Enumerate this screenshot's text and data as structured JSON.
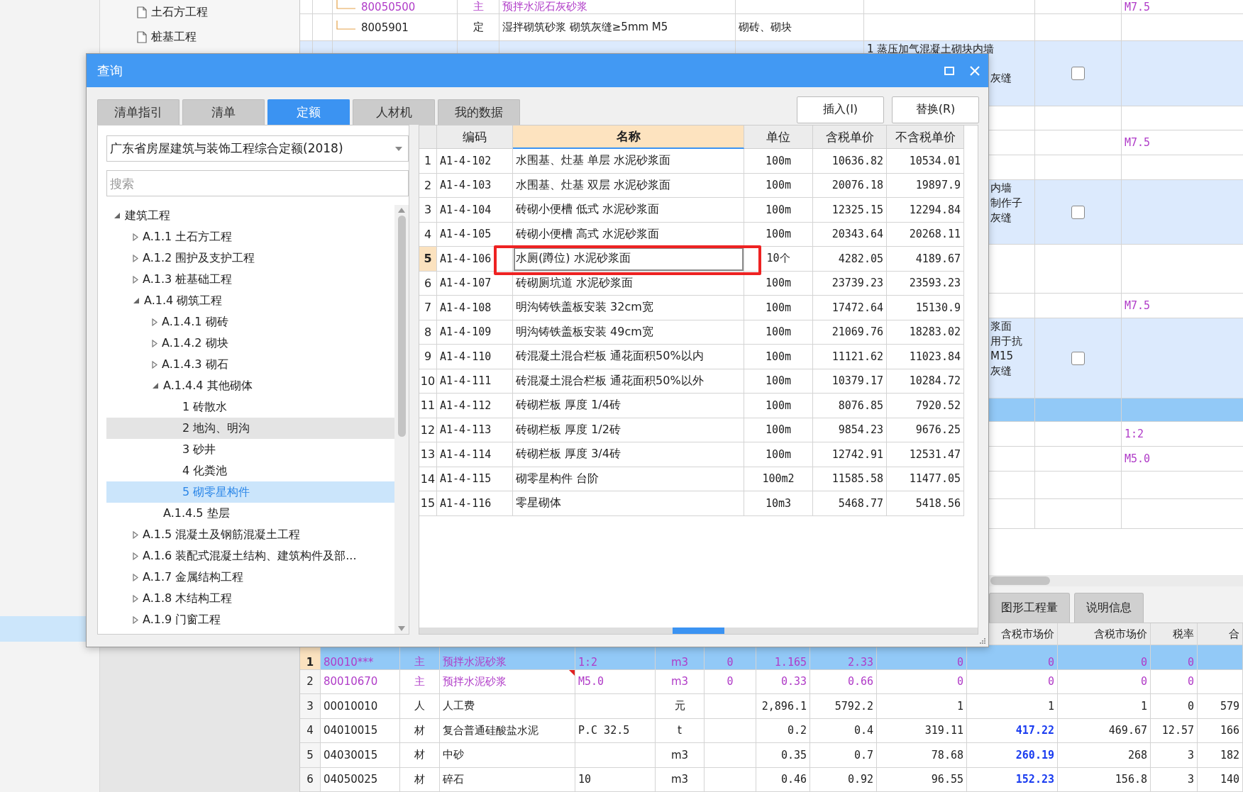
{
  "sidebar": {
    "items": [
      {
        "label": "土石方工程"
      },
      {
        "label": "桩基工程"
      }
    ]
  },
  "top_table": {
    "rows": [
      {
        "kind": "material",
        "selected": false,
        "code": "80050500",
        "type": "主",
        "name": "预拌水泥石灰砂浆",
        "ratio": "M7.5"
      },
      {
        "kind": "quota",
        "selected": false,
        "code": "8005901",
        "type": "定",
        "name": "湿拌砌筑砂浆 砌筑灰缝≥5mm M5",
        "spec": "砌砖、砌块"
      },
      {
        "kind": "item",
        "selected": false,
        "checked": false,
        "description": [
          {
            "text": "1 蒸压加气混凝土砌块内墙",
            "partial": false
          },
          {
            "text": "灰缝",
            "partial": true
          }
        ]
      },
      {
        "kind": "blank",
        "selected": false
      },
      {
        "kind": "material",
        "selected": false,
        "ratio": "M7.5"
      },
      {
        "kind": "blank",
        "selected": false
      },
      {
        "kind": "item",
        "selected": false,
        "checked": false,
        "description": [
          {
            "text": "内墙",
            "partial": true
          },
          {
            "text": "制作子",
            "partial": true
          },
          {
            "text": "灰缝",
            "partial": true
          }
        ]
      },
      {
        "kind": "blank",
        "selected": false
      },
      {
        "kind": "material",
        "selected": false,
        "ratio": "M7.5"
      },
      {
        "kind": "item",
        "selected": false,
        "checked": false,
        "description": [
          {
            "text": "浆面",
            "partial": true
          },
          {
            "text": "用于抗",
            "partial": true
          },
          {
            "text": "M15",
            "partial": true
          },
          {
            "text": "灰缝",
            "partial": true
          }
        ]
      },
      {
        "kind": "blank",
        "selected": true
      },
      {
        "kind": "material",
        "selected": false,
        "ratio": "1:2"
      },
      {
        "kind": "material",
        "selected": false,
        "ratio": "M5.0"
      },
      {
        "kind": "blank",
        "selected": false
      },
      {
        "kind": "blank",
        "selected": false
      }
    ]
  },
  "bottom_tabs": [
    {
      "label": "图形工程量",
      "selected": false
    },
    {
      "label": "说明信息",
      "selected": false
    }
  ],
  "bottom_table": {
    "header": [
      "含税市场价",
      "含税市场价",
      "税率",
      "合"
    ],
    "rows": [
      {
        "selected": true,
        "kind": "main",
        "price_changed": false,
        "has_note": false,
        "cells": [
          "1",
          "80010***",
          "主",
          "预拌水泥砂浆",
          "1:2",
          "m3",
          "0",
          "1.165",
          "2.33",
          "0",
          "0",
          "0",
          "0",
          null
        ]
      },
      {
        "selected": false,
        "kind": "main",
        "price_changed": false,
        "has_note": true,
        "cells": [
          "2",
          "80010670",
          "主",
          "预拌水泥砂浆",
          "M5.0",
          "m3",
          "0",
          "0.33",
          "0.66",
          "0",
          "0",
          "0",
          "0",
          null
        ]
      },
      {
        "selected": false,
        "kind": "normal",
        "price_changed": false,
        "has_note": false,
        "cells": [
          "3",
          "00010010",
          "人",
          "人工费",
          null,
          "元",
          null,
          "2,896.1",
          "5792.2",
          "1",
          "1",
          "1",
          "0",
          "579"
        ]
      },
      {
        "selected": false,
        "kind": "normal",
        "price_changed": true,
        "has_note": false,
        "cells": [
          "4",
          "04010015",
          "材",
          "复合普通硅酸盐水泥",
          "P.C 32.5",
          "t",
          null,
          "0.2",
          "0.4",
          "319.11",
          "417.22",
          "469.67",
          "12.57",
          "166"
        ]
      },
      {
        "selected": false,
        "kind": "normal",
        "price_changed": true,
        "has_note": false,
        "cells": [
          "5",
          "04030015",
          "材",
          "中砂",
          null,
          "m3",
          null,
          "0.35",
          "0.7",
          "78.68",
          "260.19",
          "268",
          "3",
          "182"
        ]
      },
      {
        "selected": false,
        "kind": "normal",
        "price_changed": true,
        "has_note": false,
        "cells": [
          "6",
          "04050025",
          "材",
          "碎石",
          "10",
          "m3",
          null,
          "0.46",
          "0.92",
          "96.55",
          "152.23",
          "156.8",
          "3",
          "140"
        ]
      }
    ]
  },
  "dialog": {
    "title": "查询",
    "tabs": [
      {
        "label": "清单指引",
        "selected": false
      },
      {
        "label": "清单",
        "selected": false
      },
      {
        "label": "定额",
        "selected": true
      },
      {
        "label": "人材机",
        "selected": false
      },
      {
        "label": "我的数据",
        "selected": false
      }
    ],
    "buttons": [
      "插入(I)",
      "替换(R)"
    ],
    "library": "广东省房屋建筑与装饰工程综合定额(2018)",
    "search_placeholder": "搜索",
    "tree": [
      {
        "label": "建筑工程",
        "expanded": true,
        "selected": false,
        "hovered": false,
        "children": [
          {
            "label": "A.1.1 土石方工程",
            "expanded": false,
            "selected": false,
            "hovered": false
          },
          {
            "label": "A.1.2 围护及支护工程",
            "expanded": false,
            "selected": false,
            "hovered": false
          },
          {
            "label": "A.1.3 桩基础工程",
            "expanded": false,
            "selected": false,
            "hovered": false
          },
          {
            "label": "A.1.4 砌筑工程",
            "expanded": true,
            "selected": false,
            "hovered": false,
            "children": [
              {
                "label": "A.1.4.1 砌砖",
                "expanded": false,
                "selected": false,
                "hovered": false
              },
              {
                "label": "A.1.4.2 砌块",
                "expanded": false,
                "selected": false,
                "hovered": false
              },
              {
                "label": "A.1.4.3 砌石",
                "expanded": false,
                "selected": false,
                "hovered": false
              },
              {
                "label": "A.1.4.4 其他砌体",
                "expanded": true,
                "selected": false,
                "hovered": false,
                "children": [
                  {
                    "label": "1 砖散水",
                    "selected": false,
                    "hovered": false
                  },
                  {
                    "label": "2 地沟、明沟",
                    "selected": false,
                    "hovered": true
                  },
                  {
                    "label": "3 砂井",
                    "selected": false,
                    "hovered": false
                  },
                  {
                    "label": "4 化粪池",
                    "selected": false,
                    "hovered": false
                  },
                  {
                    "label": "5 砌零星构件",
                    "selected": true,
                    "hovered": false
                  }
                ]
              },
              {
                "label": "A.1.4.5 垫层",
                "selected": false,
                "hovered": false
              }
            ]
          },
          {
            "label": "A.1.5 混凝土及钢筋混凝土工程",
            "expanded": false,
            "selected": false,
            "hovered": false
          },
          {
            "label": "A.1.6 装配式混凝土结构、建筑构件及部...",
            "expanded": false,
            "selected": false,
            "hovered": false
          },
          {
            "label": "A.1.7 金属结构工程",
            "expanded": false,
            "selected": false,
            "hovered": false
          },
          {
            "label": "A.1.8 木结构工程",
            "expanded": false,
            "selected": false,
            "hovered": false
          },
          {
            "label": "A.1.9 门窗工程",
            "expanded": false,
            "selected": false,
            "hovered": false
          }
        ]
      }
    ],
    "table": {
      "columns": [
        {
          "label": "编码",
          "selected": false
        },
        {
          "label": "名称",
          "selected": true
        },
        {
          "label": "单位",
          "selected": false
        },
        {
          "label": "含税单价",
          "selected": false
        },
        {
          "label": "不含税单价",
          "selected": false
        }
      ],
      "rows": [
        {
          "number": "1",
          "code": "A1-4-102",
          "name": "水围基、灶基 单层 水泥砂浆面",
          "unit": "100m",
          "price_tax": "10636.82",
          "price": "10534.01",
          "selected": false
        },
        {
          "number": "2",
          "code": "A1-4-103",
          "name": "水围基、灶基 双层 水泥砂浆面",
          "unit": "100m",
          "price_tax": "20076.18",
          "price": "19897.9",
          "selected": false
        },
        {
          "number": "3",
          "code": "A1-4-104",
          "name": "砖砌小便槽 低式 水泥砂浆面",
          "unit": "100m",
          "price_tax": "12325.15",
          "price": "12294.84",
          "selected": false
        },
        {
          "number": "4",
          "code": "A1-4-105",
          "name": "砖砌小便槽 高式 水泥砂浆面",
          "unit": "100m",
          "price_tax": "20343.64",
          "price": "20268.11",
          "selected": false
        },
        {
          "number": "5",
          "code": "A1-4-106",
          "name": "水厕(蹲位) 水泥砂浆面",
          "unit": "10个",
          "price_tax": "4282.05",
          "price": "4189.67",
          "selected": true
        },
        {
          "number": "6",
          "code": "A1-4-107",
          "name": "砖砌厕坑道 水泥砂浆面",
          "unit": "100m",
          "price_tax": "23739.23",
          "price": "23593.23",
          "selected": false
        },
        {
          "number": "7",
          "code": "A1-4-108",
          "name": "明沟铸铁盖板安装 32cm宽",
          "unit": "100m",
          "price_tax": "17472.64",
          "price": "15130.9",
          "selected": false
        },
        {
          "number": "8",
          "code": "A1-4-109",
          "name": "明沟铸铁盖板安装 49cm宽",
          "unit": "100m",
          "price_tax": "21069.76",
          "price": "18283.02",
          "selected": false
        },
        {
          "number": "9",
          "code": "A1-4-110",
          "name": "砖混凝土混合栏板 通花面积50%以内",
          "unit": "100m",
          "price_tax": "11121.62",
          "price": "11023.84",
          "selected": false
        },
        {
          "number": "10",
          "code": "A1-4-111",
          "name": "砖混凝土混合栏板 通花面积50%以外",
          "unit": "100m",
          "price_tax": "10379.17",
          "price": "10284.72",
          "selected": false
        },
        {
          "number": "11",
          "code": "A1-4-112",
          "name": "砖砌栏板 厚度 1/4砖",
          "unit": "100m",
          "price_tax": "8076.85",
          "price": "7920.52",
          "selected": false
        },
        {
          "number": "12",
          "code": "A1-4-113",
          "name": "砖砌栏板 厚度 1/2砖",
          "unit": "100m",
          "price_tax": "9854.23",
          "price": "9676.25",
          "selected": false
        },
        {
          "number": "13",
          "code": "A1-4-114",
          "name": "砖砌栏板 厚度 3/4砖",
          "unit": "100m",
          "price_tax": "12742.91",
          "price": "12531.47",
          "selected": false
        },
        {
          "number": "14",
          "code": "A1-4-115",
          "name": "砌零星构件 台阶",
          "unit": "100m2",
          "price_tax": "11585.58",
          "price": "11477.05",
          "selected": false
        },
        {
          "number": "15",
          "code": "A1-4-116",
          "name": "零星砌体",
          "unit": "10m3",
          "price_tax": "5468.77",
          "price": "5418.56",
          "selected": false
        }
      ]
    }
  }
}
